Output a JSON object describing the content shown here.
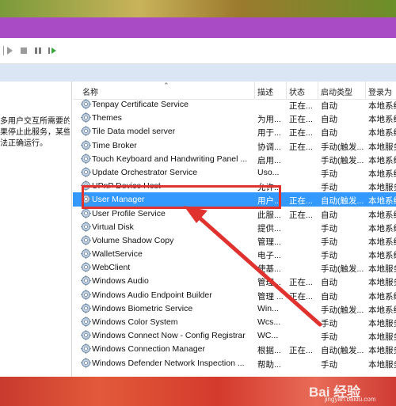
{
  "left_panel": {
    "description": "多用户交互所需要的\n果停止此服务，某些\n法正确运行。"
  },
  "columns": {
    "name": "名称",
    "description": "描述",
    "status": "状态",
    "startup": "启动类型",
    "logon": "登录为"
  },
  "services": [
    {
      "name": "Tenpay Certificate Service",
      "description": "",
      "status": "正在...",
      "startup": "自动",
      "logon": "本地系统"
    },
    {
      "name": "Themes",
      "description": "为用...",
      "status": "正在...",
      "startup": "自动",
      "logon": "本地系统"
    },
    {
      "name": "Tile Data model server",
      "description": "用于...",
      "status": "正在...",
      "startup": "自动",
      "logon": "本地系统"
    },
    {
      "name": "Time Broker",
      "description": "协调...",
      "status": "正在...",
      "startup": "手动(触发...",
      "logon": "本地服务"
    },
    {
      "name": "Touch Keyboard and Handwriting Panel ...",
      "description": "启用...",
      "status": "",
      "startup": "手动(触发...",
      "logon": "本地系统"
    },
    {
      "name": "Update Orchestrator Service",
      "description": "Uso...",
      "status": "",
      "startup": "手动",
      "logon": "本地系统"
    },
    {
      "name": "UPnP Device Host",
      "description": "允许...",
      "status": "",
      "startup": "手动",
      "logon": "本地服务"
    },
    {
      "name": "User Manager",
      "description": "用户...",
      "status": "正在...",
      "startup": "自动(触发...",
      "logon": "本地系统"
    },
    {
      "name": "User Profile Service",
      "description": "此服...",
      "status": "正在...",
      "startup": "自动",
      "logon": "本地系统"
    },
    {
      "name": "Virtual Disk",
      "description": "提供...",
      "status": "",
      "startup": "手动",
      "logon": "本地系统"
    },
    {
      "name": "Volume Shadow Copy",
      "description": "管理...",
      "status": "",
      "startup": "手动",
      "logon": "本地系统"
    },
    {
      "name": "WalletService",
      "description": "电子...",
      "status": "",
      "startup": "手动",
      "logon": "本地系统"
    },
    {
      "name": "WebClient",
      "description": "使基...",
      "status": "",
      "startup": "手动(触发...",
      "logon": "本地服务"
    },
    {
      "name": "Windows Audio",
      "description": "管理...",
      "status": "正在...",
      "startup": "自动",
      "logon": "本地服务"
    },
    {
      "name": "Windows Audio Endpoint Builder",
      "description": "管理 ...",
      "status": "正在...",
      "startup": "自动",
      "logon": "本地系统"
    },
    {
      "name": "Windows Biometric Service",
      "description": "Win...",
      "status": "",
      "startup": "手动(触发...",
      "logon": "本地系统"
    },
    {
      "name": "Windows Color System",
      "description": "Wcs...",
      "status": "",
      "startup": "手动",
      "logon": "本地服务"
    },
    {
      "name": "Windows Connect Now - Config Registrar",
      "description": "WC...",
      "status": "",
      "startup": "手动",
      "logon": "本地服务"
    },
    {
      "name": "Windows Connection Manager",
      "description": "根据...",
      "status": "正在...",
      "startup": "自动(触发...",
      "logon": "本地服务"
    },
    {
      "name": "Windows Defender Network Inspection ...",
      "description": "帮助...",
      "status": "",
      "startup": "手动",
      "logon": "本地服务"
    }
  ],
  "selected_index": 7,
  "watermark": {
    "text": "Bai 经验",
    "url": "jingyan.baidu.com"
  },
  "colors": {
    "titlebar": "#a94bc4",
    "selection": "#3399ff",
    "highlight": "#e0322f"
  }
}
